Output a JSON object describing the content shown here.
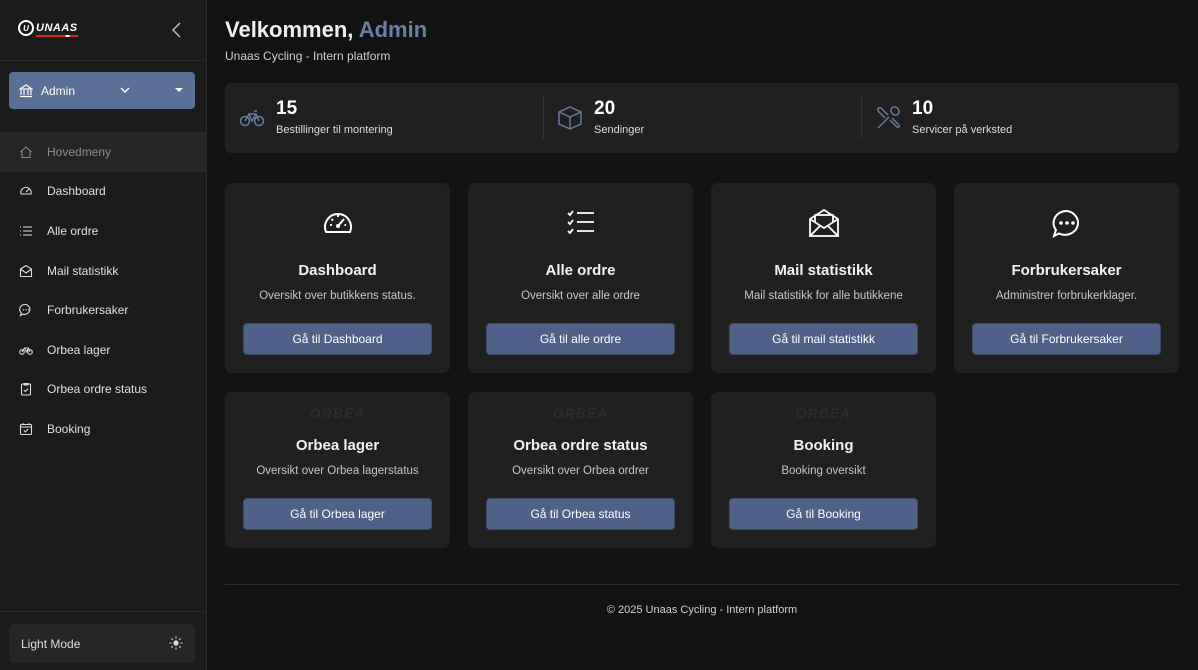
{
  "sidebar": {
    "logo_text": "UNAAS",
    "role_select": {
      "value": "Admin"
    },
    "items": [
      {
        "label": "Hovedmeny",
        "icon": "home-icon",
        "active": true
      },
      {
        "label": "Dashboard",
        "icon": "gauge-icon"
      },
      {
        "label": "Alle ordre",
        "icon": "list-icon"
      },
      {
        "label": "Mail statistikk",
        "icon": "mail-icon"
      },
      {
        "label": "Forbrukersaker",
        "icon": "chat-icon"
      },
      {
        "label": "Orbea lager",
        "icon": "bike-icon"
      },
      {
        "label": "Orbea ordre status",
        "icon": "clipboard-check-icon"
      },
      {
        "label": "Booking",
        "icon": "calendar-check-icon"
      }
    ],
    "light_mode_label": "Light Mode"
  },
  "header": {
    "greeting": "Velkommen,",
    "user": "Admin",
    "subtitle": "Unaas Cycling - Intern platform"
  },
  "stats": [
    {
      "value": "15",
      "label": "Bestillinger til montering",
      "icon": "bike-icon"
    },
    {
      "value": "20",
      "label": "Sendinger",
      "icon": "box-icon"
    },
    {
      "value": "10",
      "label": "Servicer på verksted",
      "icon": "tools-icon"
    }
  ],
  "cards": [
    {
      "title": "Dashboard",
      "desc": "Oversikt over butikkens status.",
      "button": "Gå til Dashboard",
      "icon": "gauge-icon"
    },
    {
      "title": "Alle ordre",
      "desc": "Oversikt over alle ordre",
      "button": "Gå til alle ordre",
      "icon": "checklist-icon"
    },
    {
      "title": "Mail statistikk",
      "desc": "Mail statistikk for alle butikkene",
      "button": "Gå til mail statistikk",
      "icon": "envelope-open-icon"
    },
    {
      "title": "Forbrukersaker",
      "desc": "Administrer forbrukerklager.",
      "button": "Gå til Forbrukersaker",
      "icon": "chat-dots-icon"
    },
    {
      "title": "Orbea lager",
      "desc": "Oversikt over Orbea lagerstatus",
      "button": "Gå til Orbea lager",
      "icon": "orbea-logo",
      "brand": "ORBEA"
    },
    {
      "title": "Orbea ordre status",
      "desc": "Oversikt over Orbea ordrer",
      "button": "Gå til Orbea status",
      "icon": "orbea-logo",
      "brand": "ORBEA"
    },
    {
      "title": "Booking",
      "desc": "Booking oversikt",
      "button": "Gå til Booking",
      "icon": "orbea-logo",
      "brand": "ORBEA"
    }
  ],
  "footer": "© 2025 Unaas Cycling - Intern platform",
  "colors": {
    "accent": "#6a7ea6",
    "button": "#4f6188",
    "select": "#5a6f96",
    "background": "#121212",
    "card": "#202020"
  }
}
